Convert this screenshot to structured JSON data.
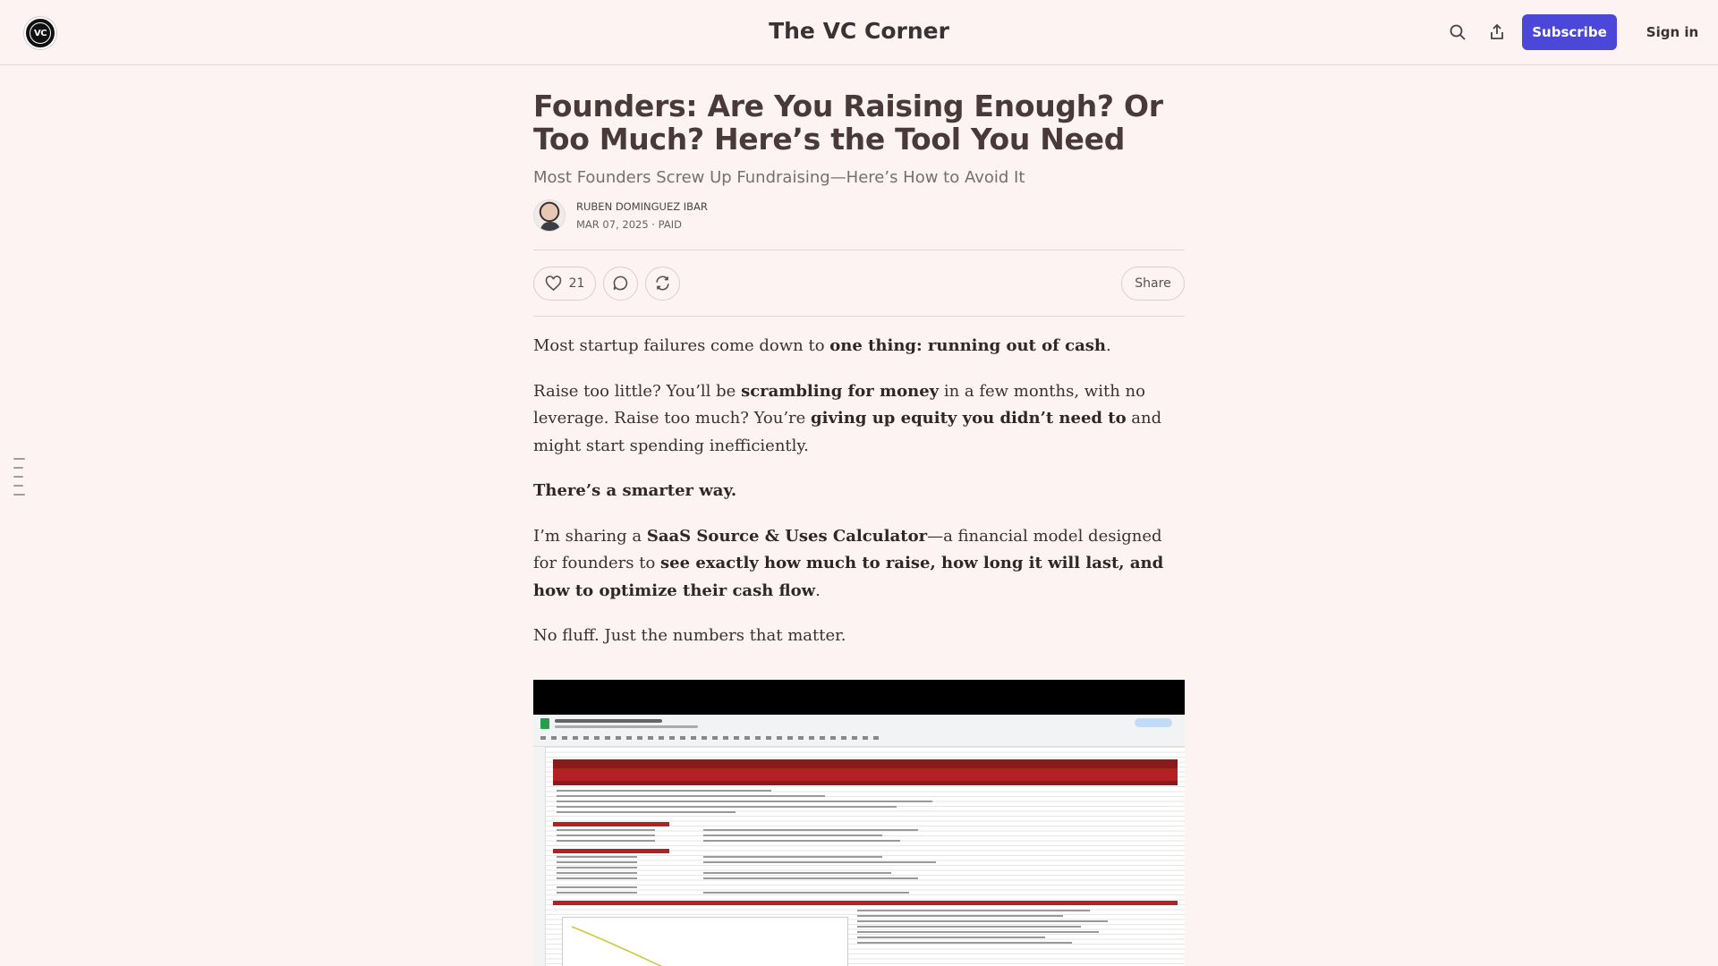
{
  "header": {
    "logo_text": "VC",
    "site_title": "The VC Corner",
    "subscribe_label": "Subscribe",
    "signin_label": "Sign in"
  },
  "post": {
    "title": "Founders: Are You Raising Enough? Or Too Much? Here’s the Tool You Need",
    "subtitle": "Most Founders Screw Up Fundraising—Here’s How to Avoid It",
    "author": "RUBEN DOMINGUEZ IBAR",
    "date": "MAR 07, 2025",
    "access": "PAID",
    "likes": "21",
    "share_label": "Share"
  },
  "body": {
    "p1_a": "Most startup failures come down to ",
    "p1_b": "one thing: running out of cash",
    "p1_c": ".",
    "p2_a": "Raise too little? You’ll be ",
    "p2_b": "scrambling for money",
    "p2_c": " in a few months, with no leverage. Raise too much? You’re ",
    "p2_d": "giving up equity you didn’t need to",
    "p2_e": " and might start spending inefficiently.",
    "p3": "There’s a smarter way.",
    "p4_a": "I’m sharing a ",
    "p4_b": "SaaS Source & Uses Calculator",
    "p4_c": "—a financial model designed for founders to ",
    "p4_d": "see exactly how much to raise, how long it will last, and how to optimize their cash flow",
    "p4_e": ".",
    "p5": "No fluff. Just the numbers that matter."
  }
}
